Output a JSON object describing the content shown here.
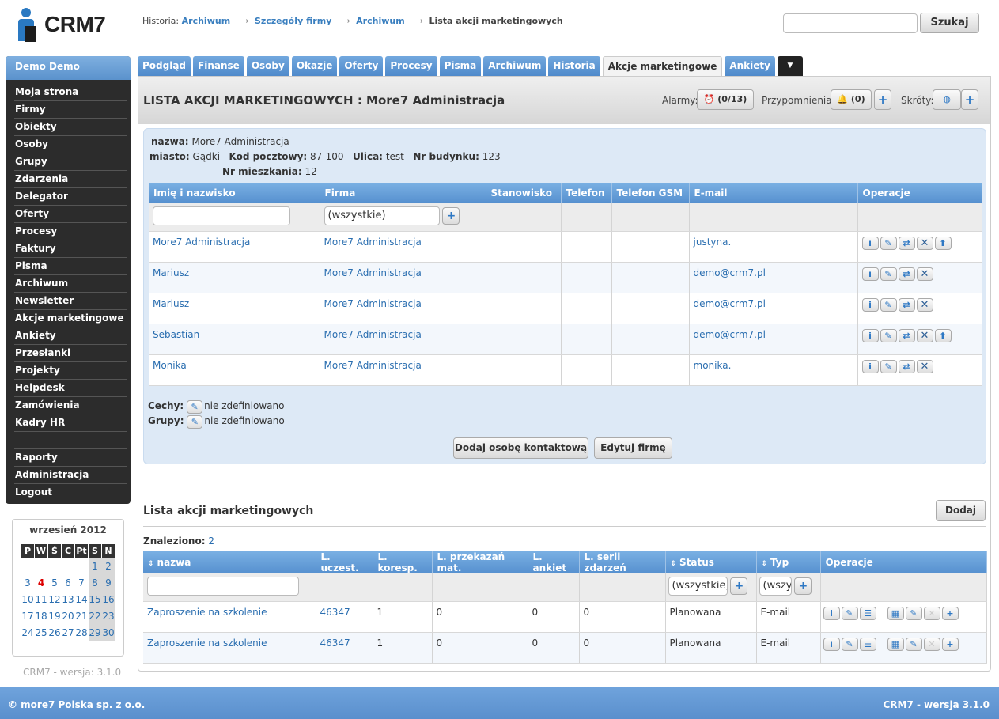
{
  "app": {
    "name": "CRM7"
  },
  "breadcrumb": {
    "label": "Historia:",
    "items": [
      "Archiwum",
      "Szczegóły firmy",
      "Archiwum"
    ],
    "current": "Lista akcji marketingowych"
  },
  "search": {
    "value": "",
    "button": "Szukaj"
  },
  "sidebar": {
    "user": "Demo Demo",
    "items": [
      "Moja strona",
      "Firmy",
      "Obiekty",
      "Osoby",
      "Grupy",
      "Zdarzenia",
      "Delegator",
      "Oferty",
      "Procesy",
      "Faktury",
      "Pisma",
      "Archiwum",
      "Newsletter",
      "Akcje marketingowe",
      "Ankiety",
      "Przesłanki",
      "Projekty",
      "Helpdesk",
      "Zamówienia",
      "Kadry HR"
    ],
    "bottom_items": [
      "Raporty",
      "Administracja",
      "Logout"
    ]
  },
  "calendar": {
    "title": "wrzesień 2012",
    "days_header": [
      "P",
      "W",
      "Ś",
      "C",
      "Pt",
      "S",
      "N"
    ],
    "weeks": [
      [
        "",
        "",
        "",
        "",
        "",
        "1",
        "2"
      ],
      [
        "3",
        "4",
        "5",
        "6",
        "7",
        "8",
        "9"
      ],
      [
        "10",
        "11",
        "12",
        "13",
        "14",
        "15",
        "16"
      ],
      [
        "17",
        "18",
        "19",
        "20",
        "21",
        "22",
        "23"
      ],
      [
        "24",
        "25",
        "26",
        "27",
        "28",
        "29",
        "30"
      ]
    ],
    "today": "4",
    "version": "CRM7 - wersja: 3.1.0"
  },
  "tabs": [
    "Podgląd",
    "Finanse",
    "Osoby",
    "Okazje",
    "Oferty",
    "Procesy",
    "Pisma",
    "Archiwum",
    "Historia",
    "Akcje marketingowe",
    "Ankiety",
    "▼"
  ],
  "active_tab": "Akcje marketingowe",
  "header": {
    "title": "LISTA AKCJI MARKETINGOWYCH : More7 Administracja",
    "alarmy_label": "Alarmy:",
    "alarmy_value": "(0/13)",
    "przypomnienia_label": "Przypomnienia:",
    "przypomnienia_value": "(0)",
    "skroty_label": "Skróty:"
  },
  "company": {
    "nazwa_label": "nazwa:",
    "nazwa": "More7 Administracja",
    "miasto_label": "miasto:",
    "miasto": "Gądki",
    "kod_label": "Kod pocztowy:",
    "kod": "87-100",
    "ulica_label": "Ulica:",
    "ulica": "test",
    "budynek_label": "Nr budynku:",
    "budynek": "123",
    "mieszkanie_label": "Nr mieszkania:",
    "mieszkanie": "12",
    "cechy_label": "Cechy:",
    "cechy": "nie zdefiniowano",
    "grupy_label": "Grupy:",
    "grupy": "nie zdefiniowano",
    "add_contact_button": "Dodaj osobę kontaktową",
    "edit_company_button": "Edytuj firmę"
  },
  "contacts": {
    "columns": [
      "Imię i nazwisko",
      "Firma",
      "Stanowisko",
      "Telefon",
      "Telefon GSM",
      "E-mail",
      "Operacje"
    ],
    "firma_filter": "(wszystkie)",
    "rows": [
      {
        "name": "More7 Administracja",
        "firma": "More7 Administracja",
        "email": "justyna."
      },
      {
        "name": "Mariusz",
        "firma": "More7 Administracja",
        "email": "demo@crm7.pl"
      },
      {
        "name": "Mariusz",
        "firma": "More7 Administracja",
        "email": "demo@crm7.pl"
      },
      {
        "name": "Sebastian",
        "firma": "More7 Administracja",
        "email": "demo@crm7.pl"
      },
      {
        "name": "Monika",
        "firma": "More7 Administracja",
        "email": "monika."
      }
    ]
  },
  "actions": {
    "title": "Lista akcji marketingowych",
    "add_button": "Dodaj",
    "found_label": "Znaleziono:",
    "found_value": "2",
    "columns": [
      "nazwa",
      "L. uczest.",
      "L. koresp.",
      "L. przekazań mat.",
      "L. ankiet",
      "L. serii zdarzeń",
      "Status",
      "Typ",
      "Operacje"
    ],
    "status_filter": "(wszystkie)",
    "typ_filter": "(wszy",
    "rows": [
      {
        "nazwa": "Zaproszenie na szkolenie",
        "uczest": "46347",
        "koresp": "1",
        "przekazan": "0",
        "ankiet": "0",
        "serii": "0",
        "status": "Planowana",
        "typ": "E-mail"
      },
      {
        "nazwa": "Zaproszenie na szkolenie",
        "uczest": "46347",
        "koresp": "1",
        "przekazan": "0",
        "ankiet": "0",
        "serii": "0",
        "status": "Planowana",
        "typ": "E-mail"
      }
    ]
  },
  "footer": {
    "left": "© more7 Polska sp. z o.o.",
    "right": "CRM7 - wersja 3.1.0"
  }
}
